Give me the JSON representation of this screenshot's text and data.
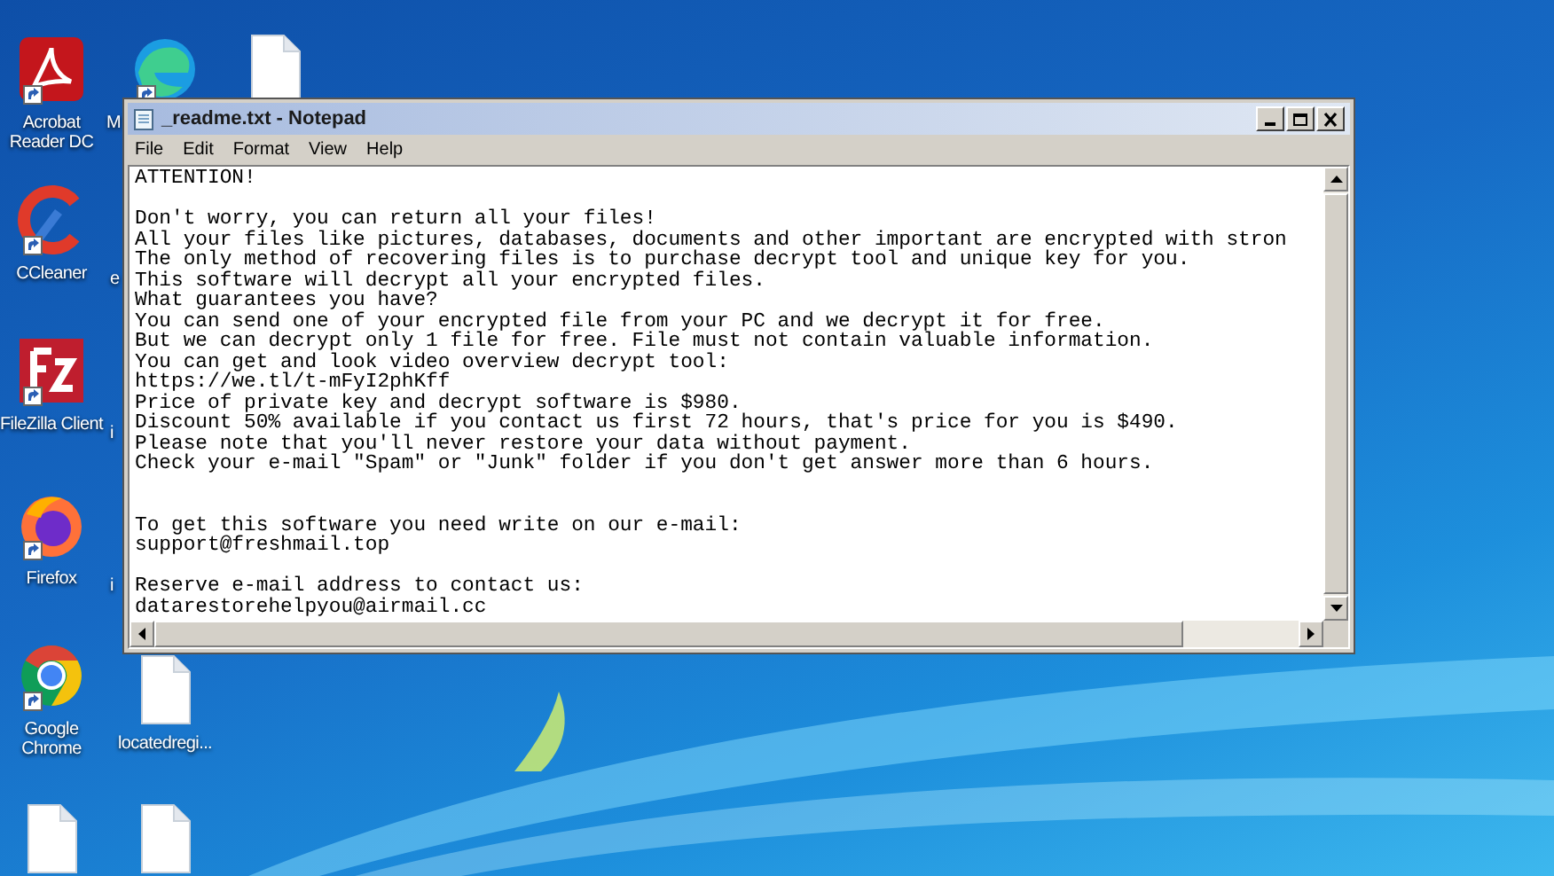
{
  "desktop_icons": [
    {
      "kind": "acrobat",
      "label": "Acrobat Reader DC",
      "shortcut": true
    },
    {
      "kind": "ccleaner",
      "label": "CCleaner",
      "shortcut": true
    },
    {
      "kind": "filezilla",
      "label": "FileZilla Client",
      "shortcut": true
    },
    {
      "kind": "firefox",
      "label": "Firefox",
      "shortcut": true
    },
    {
      "kind": "chrome",
      "label": "Google Chrome",
      "shortcut": true
    },
    {
      "kind": "file"
    },
    {
      "kind": "edge",
      "label": "M",
      "shortcut": true
    },
    {
      "kind": "file"
    },
    {
      "kind": "hidden",
      "label": "e"
    },
    {
      "kind": "hidden",
      "label": "i"
    },
    {
      "kind": "hidden",
      "label": "i"
    },
    {
      "kind": "file",
      "label": "locatedregi..."
    },
    {
      "kind": "file"
    }
  ],
  "window": {
    "title": "_readme.txt - Notepad",
    "menu": [
      "File",
      "Edit",
      "Format",
      "View",
      "Help"
    ],
    "content": "ATTENTION!\n\nDon't worry, you can return all your files!\nAll your files like pictures, databases, documents and other important are encrypted with stron\nThe only method of recovering files is to purchase decrypt tool and unique key for you.\nThis software will decrypt all your encrypted files.\nWhat guarantees you have?\nYou can send one of your encrypted file from your PC and we decrypt it for free.\nBut we can decrypt only 1 file for free. File must not contain valuable information.\nYou can get and look video overview decrypt tool:\nhttps://we.tl/t-mFyI2phKff\nPrice of private key and decrypt software is $980.\nDiscount 50% available if you contact us first 72 hours, that's price for you is $490.\nPlease note that you'll never restore your data without payment.\nCheck your e-mail \"Spam\" or \"Junk\" folder if you don't get answer more than 6 hours.\n\n\nTo get this software you need write on our e-mail:\nsupport@freshmail.top\n\nReserve e-mail address to contact us:\ndatarestorehelpyou@airmail.cc"
  }
}
